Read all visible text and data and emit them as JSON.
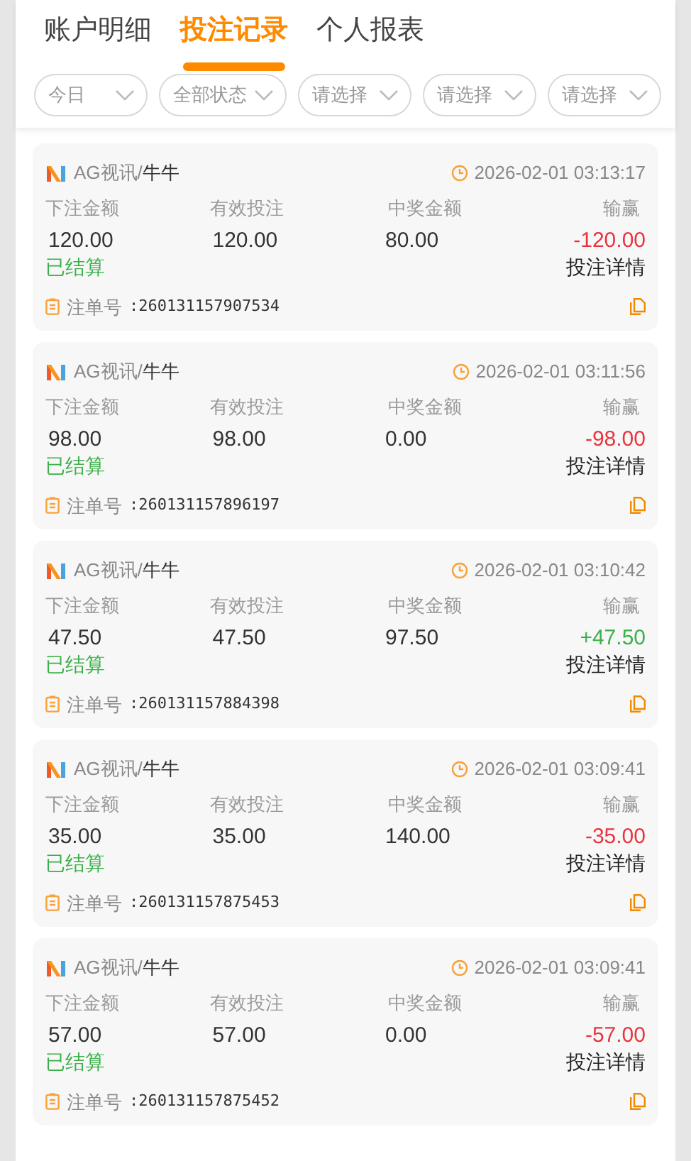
{
  "tabs": [
    {
      "label": "账户明细",
      "selected": false
    },
    {
      "label": "投注记录",
      "selected": true
    },
    {
      "label": "个人报表",
      "selected": false
    }
  ],
  "filters": [
    "今日",
    "全部状态",
    "请选择",
    "请选择",
    "请选择"
  ],
  "records": [
    {
      "platform": "AG视讯",
      "separator": "/",
      "game": "牛牛",
      "time": "2026-02-01 03:13:17",
      "column_labels": [
        "下注金额",
        "有效投注",
        "中奖金额",
        "输赢"
      ],
      "bet": "120.00",
      "valid": "120.00",
      "payout": "80.00",
      "profit": "-120.00",
      "color": "#e8343f",
      "status": "已结算",
      "detail": "投注详情",
      "order_label": "注单号",
      "order_no": ":260131157907534"
    },
    {
      "platform": "AG视讯",
      "separator": "/",
      "game": "牛牛",
      "time": "2026-02-01 03:11:56",
      "column_labels": [
        "下注金额",
        "有效投注",
        "中奖金额",
        "输赢"
      ],
      "bet": "98.00",
      "valid": "98.00",
      "payout": "0.00",
      "profit": "-98.00",
      "color": "#e8343f",
      "status": "已结算",
      "detail": "投注详情",
      "order_label": "注单号",
      "order_no": ":260131157896197"
    },
    {
      "platform": "AG视讯",
      "separator": "/",
      "game": "牛牛",
      "time": "2026-02-01 03:10:42",
      "column_labels": [
        "下注金额",
        "有效投注",
        "中奖金额",
        "输赢"
      ],
      "bet": "47.50",
      "valid": "47.50",
      "payout": "97.50",
      "profit": "+47.50",
      "color": "#3cb04a",
      "status": "已结算",
      "detail": "投注详情",
      "order_label": "注单号",
      "order_no": ":260131157884398"
    },
    {
      "platform": "AG视讯",
      "separator": "/",
      "game": "牛牛",
      "time": "2026-02-01 03:09:41",
      "column_labels": [
        "下注金额",
        "有效投注",
        "中奖金额",
        "输赢"
      ],
      "bet": "35.00",
      "valid": "35.00",
      "payout": "140.00",
      "profit": "-35.00",
      "color": "#e8343f",
      "status": "已结算",
      "detail": "投注详情",
      "order_label": "注单号",
      "order_no": ":260131157875453"
    },
    {
      "platform": "AG视讯",
      "separator": "/",
      "game": "牛牛",
      "time": "2026-02-01 03:09:41",
      "column_labels": [
        "下注金额",
        "有效投注",
        "中奖金额",
        "输赢"
      ],
      "bet": "57.00",
      "valid": "57.00",
      "payout": "0.00",
      "profit": "-57.00",
      "color": "#e8343f",
      "status": "已结算",
      "detail": "投注详情",
      "order_label": "注单号",
      "order_no": ":260131157875452"
    }
  ]
}
